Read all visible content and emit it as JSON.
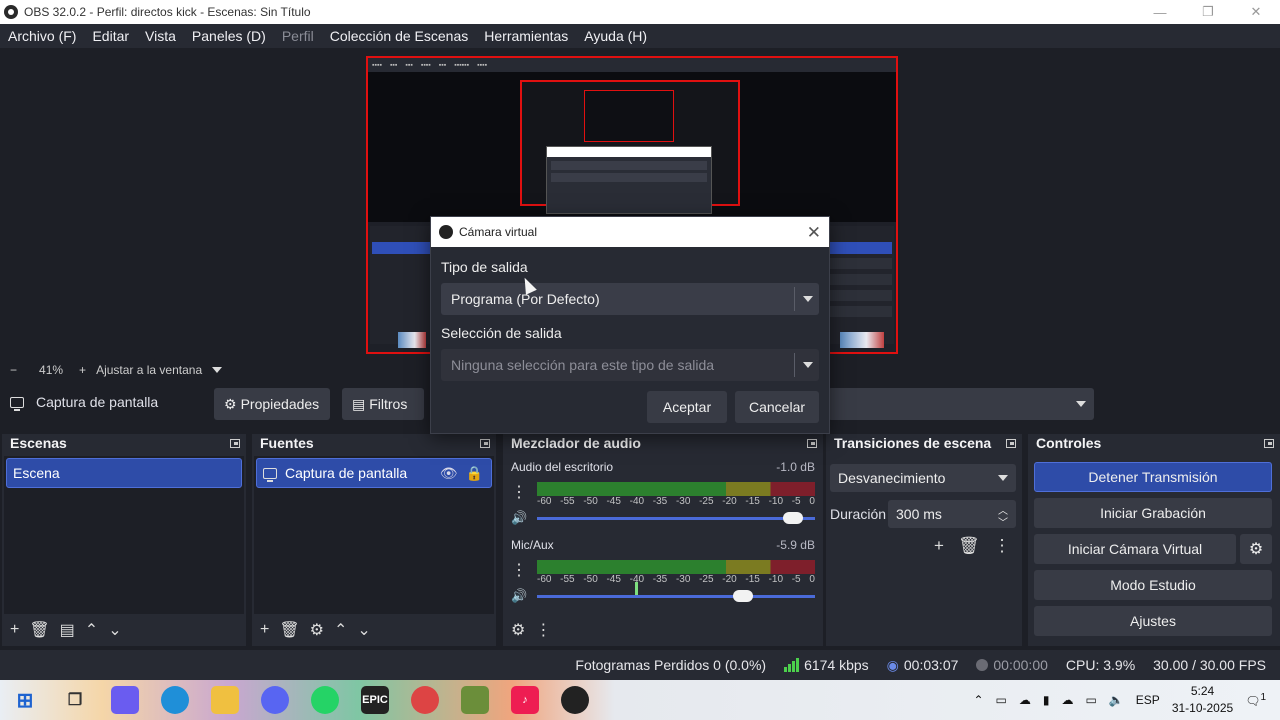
{
  "window": {
    "title": "OBS 32.0.2 - Perfil: directos kick - Escenas: Sin Título",
    "minimize": "—",
    "maximize": "❐",
    "close": "✕"
  },
  "menu": [
    {
      "label": "Archivo (F)",
      "enabled": true
    },
    {
      "label": "Editar",
      "enabled": true
    },
    {
      "label": "Vista",
      "enabled": true
    },
    {
      "label": "Paneles (D)",
      "enabled": true
    },
    {
      "label": "Perfil",
      "enabled": false
    },
    {
      "label": "Colección de Escenas",
      "enabled": true
    },
    {
      "label": "Herramientas",
      "enabled": true
    },
    {
      "label": "Ayuda (H)",
      "enabled": true
    }
  ],
  "zoom": {
    "minus": "−",
    "value": "41%",
    "plus": "+",
    "fit_label": "Ajustar a la ventana"
  },
  "source_toolbar": {
    "source_name": "Captura de pantalla",
    "properties": "Propiedades",
    "filters": "Filtros"
  },
  "scenes": {
    "title": "Escenas",
    "items": [
      "Escena"
    ]
  },
  "sources": {
    "title": "Fuentes",
    "items": [
      "Captura de pantalla"
    ]
  },
  "mixer": {
    "title": "Mezclador de audio",
    "channels": [
      {
        "name": "Audio del escritorio",
        "db": "-1.0 dB",
        "volume": 0.92
      },
      {
        "name": "Mic/Aux",
        "db": "-5.9 dB",
        "volume": 0.74
      }
    ],
    "ticks": [
      "-60",
      "-55",
      "-50",
      "-45",
      "-40",
      "-35",
      "-30",
      "-25",
      "-20",
      "-15",
      "-10",
      "-5",
      "0"
    ]
  },
  "transitions": {
    "title": "Transiciones de escena",
    "selected": "Desvanecimiento",
    "duration_label": "Duración",
    "duration_value": "300 ms"
  },
  "controls": {
    "title": "Controles",
    "stop_stream": "Detener Transmisión",
    "start_recording": "Iniciar Grabación",
    "start_virtual_cam": "Iniciar Cámara Virtual",
    "studio_mode": "Modo Estudio",
    "settings": "Ajustes"
  },
  "status": {
    "dropped_frames": "Fotogramas Perdidos 0 (0.0%)",
    "bitrate": "6174 kbps",
    "stream_time": "00:03:07",
    "record_time": "00:00:00",
    "cpu": "CPU: 3.9%",
    "fps": "30.00 / 30.00 FPS"
  },
  "dialog": {
    "title": "Cámara virtual",
    "output_type_label": "Tipo de salida",
    "output_type_value": "Programa (Por Defecto)",
    "output_selection_label": "Selección de salida",
    "output_selection_value": "Ninguna selección para este tipo de salida",
    "accept": "Aceptar",
    "cancel": "Cancelar"
  },
  "taskbar": {
    "language": "ESP",
    "time": "5:24",
    "date": "31-10-2025",
    "notifications": "1"
  },
  "colors": {
    "accent": "#2e4ca8",
    "recording_red": "#e01010",
    "meter_green": "#2e8f2e"
  }
}
